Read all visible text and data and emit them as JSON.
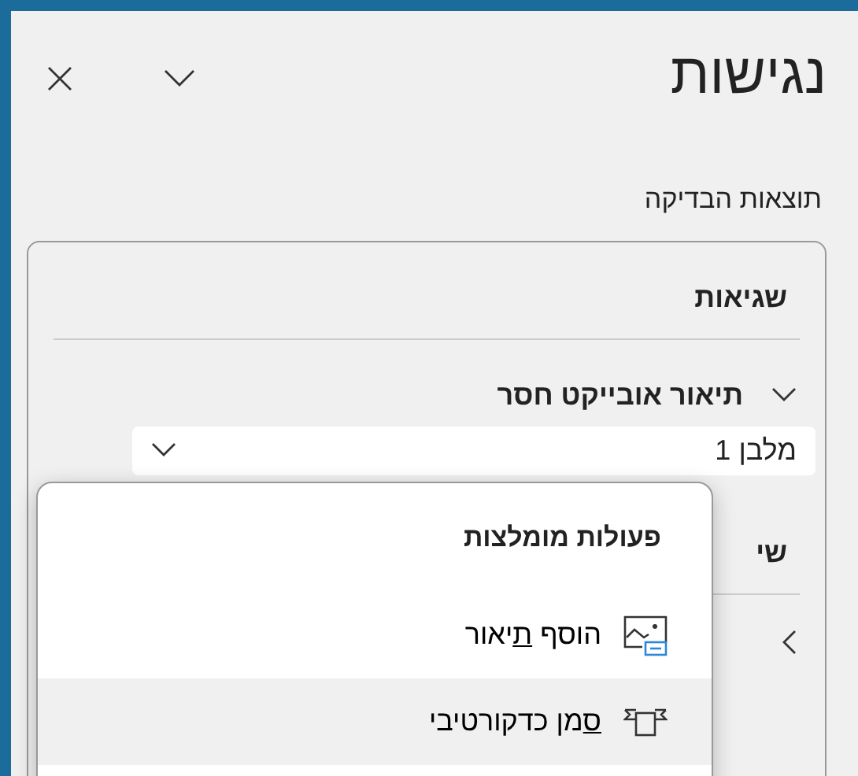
{
  "pane": {
    "title": "נגישות",
    "buttons": [
      {
        "kind": "options"
      },
      {
        "kind": "close"
      }
    ]
  },
  "subtitle": "תוצאות הבדיקה",
  "sections": [
    {
      "title": "שגיאות",
      "items": [
        {
          "label": "תיאור אובייקט חסר",
          "expanded": true,
          "children": [
            {
              "label": "מלבן 1",
              "selected": true
            }
          ]
        }
      ]
    },
    {
      "title": "שי",
      "items": [
        {
          "expanded": false
        }
      ]
    }
  ],
  "menu": {
    "title": "פעולות מומלצות",
    "items": [
      {
        "kind": "caption",
        "label_before": "הוסף ",
        "access_key": "ת",
        "label_after": "יאור",
        "highlighted": false
      },
      {
        "kind": "decorative",
        "access_key": "ס",
        "label_after": "מן כדקורטיבי",
        "highlighted": true
      }
    ]
  }
}
